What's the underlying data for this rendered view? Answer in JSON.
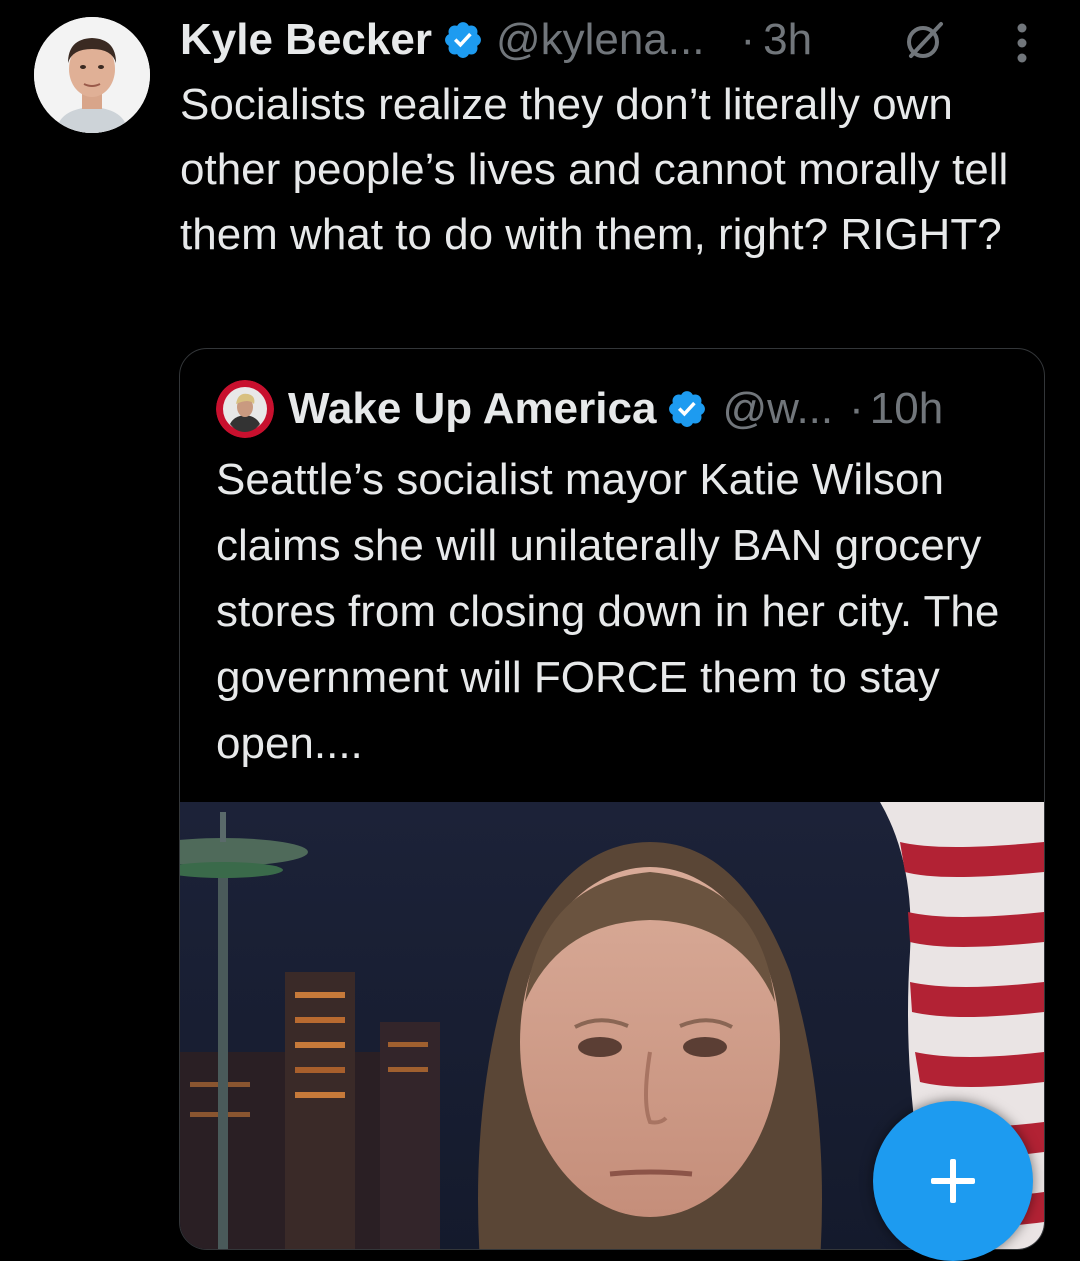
{
  "tweet": {
    "author_name": "Kyle Becker",
    "author_handle": "@kylena...",
    "time": "3h",
    "separator": "·",
    "text": "Socialists realize they don’t literally own other people’s lives and cannot morally tell them what to do with them, right? RIGHT?"
  },
  "quoted_tweet": {
    "author_name": "Wake Up America",
    "author_handle": "@w...",
    "time": "10h",
    "separator": "·",
    "text": "Seattle’s socialist mayor Katie Wilson claims she will unilaterally BAN grocery stores from closing down in her city. The government will FORCE them to stay open...."
  },
  "icons": {
    "verified": "verified-badge-icon",
    "grok": "grok-slash-icon",
    "more": "more-vertical-icon",
    "compose": "plus-icon"
  },
  "colors": {
    "background": "#000000",
    "text": "#e7e9ea",
    "secondary": "#71767b",
    "accent": "#1d9bf0",
    "border": "#333639"
  }
}
